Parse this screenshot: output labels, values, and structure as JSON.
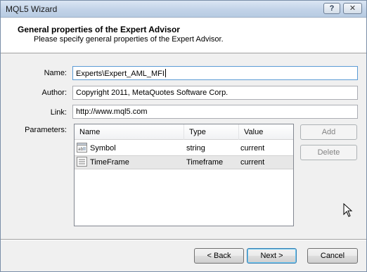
{
  "window": {
    "title": "MQL5 Wizard"
  },
  "titlebar": {
    "help_label": "?",
    "close_label": "✕"
  },
  "header": {
    "title": "General properties of the Expert Advisor",
    "subtitle": "Please specify general properties of the Expert Advisor."
  },
  "form": {
    "name_label": "Name:",
    "name_value": "Experts\\Expert_AML_MFI",
    "author_label": "Author:",
    "author_value": "Copyright 2011, MetaQuotes Software Corp.",
    "link_label": "Link:",
    "link_value": "http://www.mql5.com",
    "parameters_label": "Parameters:"
  },
  "parameters": {
    "columns": [
      "Name",
      "Type",
      "Value"
    ],
    "rows": [
      {
        "name": "Symbol",
        "type": "string",
        "value": "current",
        "icon": "text-param-icon"
      },
      {
        "name": "TimeFrame",
        "type": "Timeframe",
        "value": "current",
        "icon": "list-param-icon"
      }
    ],
    "selected_row": 1
  },
  "side_buttons": {
    "add_label": "Add",
    "delete_label": "Delete"
  },
  "footer": {
    "back_label": "< Back",
    "next_label": "Next >",
    "cancel_label": "Cancel"
  }
}
